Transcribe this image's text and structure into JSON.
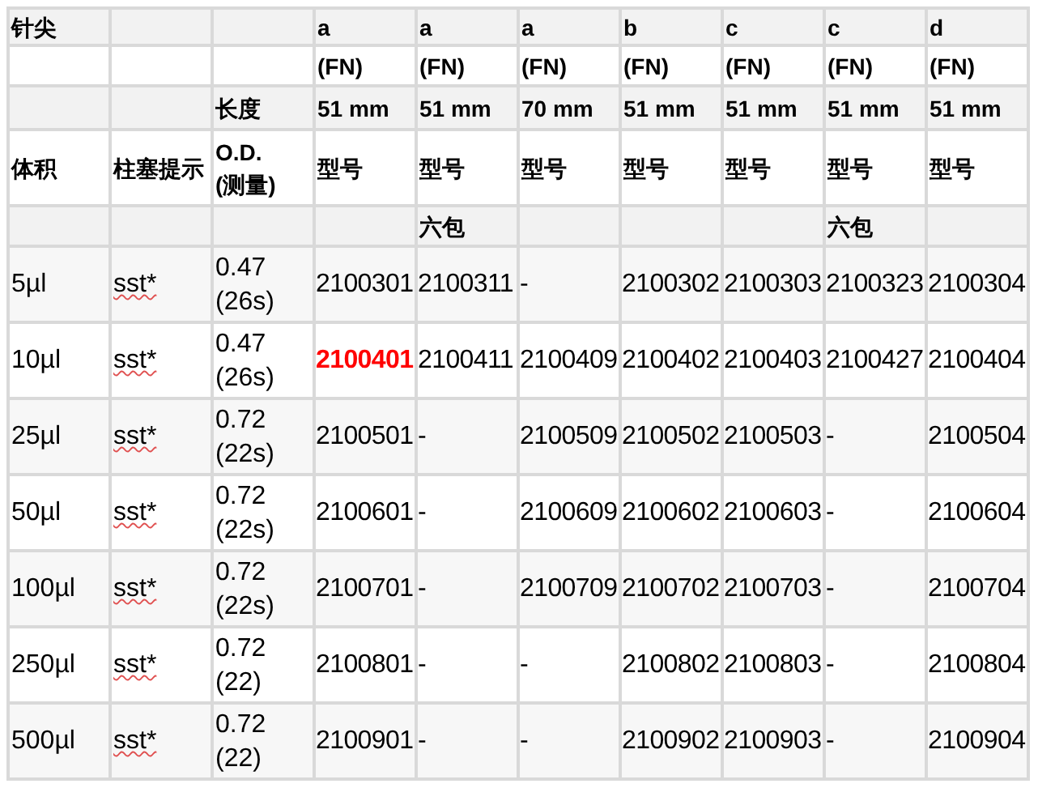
{
  "header_rows": [
    [
      "针尖",
      null,
      null,
      "a",
      "a",
      "a",
      "b",
      "c",
      "c",
      "d"
    ],
    [
      null,
      null,
      null,
      "(FN)",
      "(FN)",
      "(FN)",
      "(FN)",
      "(FN)",
      "(FN)",
      "(FN)"
    ],
    [
      null,
      null,
      "长度",
      "51 mm",
      "51 mm",
      "70 mm",
      "51 mm",
      "51 mm",
      "51 mm",
      "51 mm"
    ],
    [
      "体积",
      "柱塞提示",
      "O.D. (测量)",
      "型号",
      "型号",
      "型号",
      "型号",
      "型号",
      "型号",
      "型号"
    ],
    [
      null,
      null,
      null,
      null,
      "六包",
      null,
      null,
      null,
      "六包",
      null
    ]
  ],
  "rows": [
    {
      "volume": "5µl",
      "plunger": "sst*",
      "od": "0.47 (26s)",
      "models": [
        {
          "text": "2100301",
          "highlighted": false
        },
        {
          "text": "2100311",
          "highlighted": false
        },
        {
          "text": "-",
          "highlighted": false
        },
        {
          "text": "2100302",
          "highlighted": false
        },
        {
          "text": "2100303",
          "highlighted": false
        },
        {
          "text": "2100323",
          "highlighted": false
        },
        {
          "text": "2100304",
          "highlighted": false
        }
      ]
    },
    {
      "volume": "10µl",
      "plunger": "sst*",
      "od": "0.47 (26s)",
      "models": [
        {
          "text": "2100401",
          "highlighted": true
        },
        {
          "text": "2100411",
          "highlighted": false
        },
        {
          "text": "2100409",
          "highlighted": false
        },
        {
          "text": "2100402",
          "highlighted": false
        },
        {
          "text": "2100403",
          "highlighted": false
        },
        {
          "text": "2100427",
          "highlighted": false
        },
        {
          "text": "2100404",
          "highlighted": false
        }
      ]
    },
    {
      "volume": "25µl",
      "plunger": "sst*",
      "od": "0.72 (22s)",
      "models": [
        {
          "text": "2100501",
          "highlighted": false
        },
        {
          "text": "-",
          "highlighted": false
        },
        {
          "text": "2100509",
          "highlighted": false
        },
        {
          "text": "2100502",
          "highlighted": false
        },
        {
          "text": "2100503",
          "highlighted": false
        },
        {
          "text": "-",
          "highlighted": false
        },
        {
          "text": "2100504",
          "highlighted": false
        }
      ]
    },
    {
      "volume": "50µl",
      "plunger": "sst*",
      "od": "0.72 (22s)",
      "models": [
        {
          "text": "2100601",
          "highlighted": false
        },
        {
          "text": "-",
          "highlighted": false
        },
        {
          "text": "2100609",
          "highlighted": false
        },
        {
          "text": "2100602",
          "highlighted": false
        },
        {
          "text": "2100603",
          "highlighted": false
        },
        {
          "text": "-",
          "highlighted": false
        },
        {
          "text": "2100604",
          "highlighted": false
        }
      ]
    },
    {
      "volume": "100µl",
      "plunger": "sst*",
      "od": "0.72 (22s)",
      "models": [
        {
          "text": "2100701",
          "highlighted": false
        },
        {
          "text": "-",
          "highlighted": false
        },
        {
          "text": "2100709",
          "highlighted": false
        },
        {
          "text": "2100702",
          "highlighted": false
        },
        {
          "text": "2100703",
          "highlighted": false
        },
        {
          "text": "-",
          "highlighted": false
        },
        {
          "text": "2100704",
          "highlighted": false
        }
      ]
    },
    {
      "volume": "250µl",
      "plunger": "sst*",
      "od": "0.72 (22)",
      "models": [
        {
          "text": "2100801",
          "highlighted": false
        },
        {
          "text": "-",
          "highlighted": false
        },
        {
          "text": "-",
          "highlighted": false
        },
        {
          "text": "2100802",
          "highlighted": false
        },
        {
          "text": "2100803",
          "highlighted": false
        },
        {
          "text": "-",
          "highlighted": false
        },
        {
          "text": "2100804",
          "highlighted": false
        }
      ]
    },
    {
      "volume": "500µl",
      "plunger": "sst*",
      "od": "0.72 (22)",
      "models": [
        {
          "text": "2100901",
          "highlighted": false
        },
        {
          "text": "-",
          "highlighted": false
        },
        {
          "text": "-",
          "highlighted": false
        },
        {
          "text": "2100902",
          "highlighted": false
        },
        {
          "text": "2100903",
          "highlighted": false
        },
        {
          "text": "-",
          "highlighted": false
        },
        {
          "text": "2100904",
          "highlighted": false
        }
      ]
    }
  ]
}
